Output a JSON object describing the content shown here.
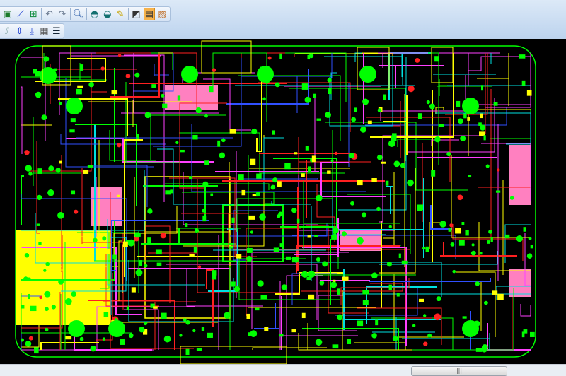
{
  "toolbar_row1": [
    "board-setup-icon",
    "route-icon",
    "component-icon",
    "undo-icon",
    "redo-icon",
    "zoom-icon",
    "view-layer-icon",
    "view-flip-icon",
    "paint-icon",
    "picture-icon",
    "window-layout-icon",
    "pcb-3d-icon"
  ],
  "toolbar_row2": [
    "unroute-icon",
    "align-icon",
    "push-down-icon",
    "array-icon",
    "list-icon"
  ],
  "active_button": "window-layout-icon",
  "colors": {
    "board_bg": "#000000",
    "trace_green": "#00ff00",
    "trace_blue": "#3050ff",
    "trace_red": "#ff2020",
    "trace_yellow": "#ffff00",
    "copper_pink": "#ff80c0",
    "trace_cyan": "#00e0e0",
    "trace_magenta": "#ff40ff"
  }
}
